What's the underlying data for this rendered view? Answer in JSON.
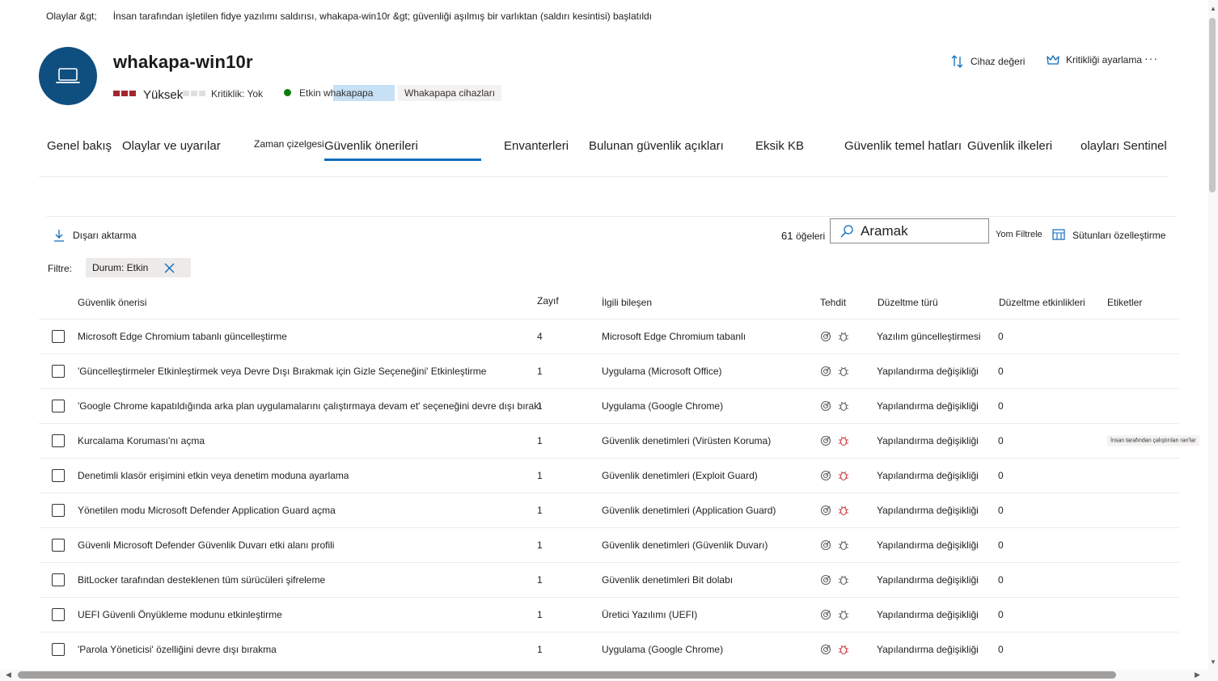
{
  "breadcrumb": {
    "root": "Olaylar &gt;",
    "current": "İnsan tarafından işletilen fidye yazılımı saldırısı, whakapa-win10r &gt; güvenliği aşılmış bir varlıktan (saldırı kesintisi) başlatıldı"
  },
  "device": {
    "icon": "laptop-icon",
    "name": "whakapa-win10r",
    "risk_label": "Yüksek",
    "criticality": "Kritiklik: Yok",
    "status": "Etkin whakapapa",
    "group_tag": "Whakapapa cihazları",
    "colors": {
      "avatar": "#0f4f80",
      "risk": "#a4262c",
      "status": "#107c10",
      "accent": "#0f6cbd"
    }
  },
  "header_actions": {
    "device_value": "Cihaz değeri",
    "set_criticality": "Kritikliği ayarlama",
    "more": "···"
  },
  "tabs": {
    "overview": "Genel bakış",
    "incidents": "Olaylar ve uyarılar",
    "timeline": "Zaman çizelgesi",
    "recommendations": "Güvenlik önerileri",
    "inventories": "Envanterleri",
    "vulnerabilities": "Bulunan güvenlik açıkları",
    "missing_kb": "Eksik KB",
    "baselines": "Güvenlik temel hatları",
    "policies": "Güvenlik ilkeleri",
    "sentinel": "olayları Sentinel"
  },
  "toolbar": {
    "export": "Dışarı aktarma",
    "count": "61",
    "count_label": "öğeleri",
    "search_value": "Aramak",
    "filter": "Yom Filtrele",
    "customize_columns": "Sütunları özelleştirme"
  },
  "filter": {
    "label": "Filtre:",
    "chip": "Durum: Etkin"
  },
  "table": {
    "headers": {
      "recommendation": "Güvenlik önerisi",
      "weakness": "Zayıf",
      "component": "İlgili bileşen",
      "threat": "Tehdit",
      "remediation_type": "Düzeltme türü",
      "activities": "Düzeltme etkinlikleri",
      "tags": "Etiketler"
    },
    "rows": [
      {
        "rec": "Microsoft Edge Chromium tabanlı güncelleştirme",
        "weak": "4",
        "comp": "Microsoft Edge Chromium tabanlı",
        "type": "Yazılım güncelleştirmesi",
        "act": "0",
        "tag": ""
      },
      {
        "rec": "'Güncelleştirmeler Etkinleştirmek veya Devre Dışı Bırakmak için Gizle Seçeneğini' Etkinleştirme",
        "weak": "1",
        "comp": "Uygulama (Microsoft Office)",
        "type": "Yapılandırma değişikliği",
        "act": "0",
        "tag": ""
      },
      {
        "rec": "'Google Chrome kapatıldığında arka plan uygulamalarını çalıştırmaya devam et' seçeneğini devre dışı bırakın",
        "weak": "1",
        "comp": "Uygulama (Google Chrome)",
        "type": "Yapılandırma değişikliği",
        "act": "0",
        "tag": ""
      },
      {
        "rec": "Kurcalama Koruması'nı açma",
        "weak": "1",
        "comp": "Güvenlik denetimleri (Virüsten Koruma)",
        "type": "Yapılandırma değişikliği",
        "act": "0",
        "tag": "İnsan tarafından çalıştırılan ran'lar"
      },
      {
        "rec": "Denetimli klasör erişimini etkin veya denetim moduna ayarlama",
        "weak": "1",
        "comp": "Güvenlik denetimleri (Exploit Guard)",
        "type": "Yapılandırma değişikliği",
        "act": "0",
        "tag": ""
      },
      {
        "rec": "Yönetilen modu Microsoft Defender Application Guard açma",
        "weak": "1",
        "comp": "Güvenlik denetimleri (Application Guard)",
        "type": "Yapılandırma değişikliği",
        "act": "0",
        "tag": ""
      },
      {
        "rec": "Güvenli Microsoft Defender Güvenlik Duvarı etki alanı profili",
        "weak": "1",
        "comp": "Güvenlik denetimleri (Güvenlik Duvarı)",
        "type": "Yapılandırma değişikliği",
        "act": "0",
        "tag": ""
      },
      {
        "rec": "BitLocker tarafından desteklenen tüm sürücüleri şifreleme",
        "weak": "1",
        "comp": "Güvenlik denetimleri Bit dolabı",
        "type": "Yapılandırma değişikliği",
        "act": "0",
        "tag": ""
      },
      {
        "rec": "UEFI Güvenli Önyükleme modunu etkinleştirme",
        "weak": "1",
        "comp": "Üretici Yazılımı (UEFI)",
        "type": "Yapılandırma değişikliği",
        "act": "0",
        "tag": ""
      },
      {
        "rec": "'Parola Yöneticisi' özelliğini devre dışı bırakma",
        "weak": "1",
        "comp": "Uygulama (Google Chrome)",
        "type": "Yapılandırma değişikliği",
        "act": "0",
        "tag": ""
      }
    ],
    "threat_bug_red_rows": [
      3,
      4,
      5,
      9
    ]
  }
}
